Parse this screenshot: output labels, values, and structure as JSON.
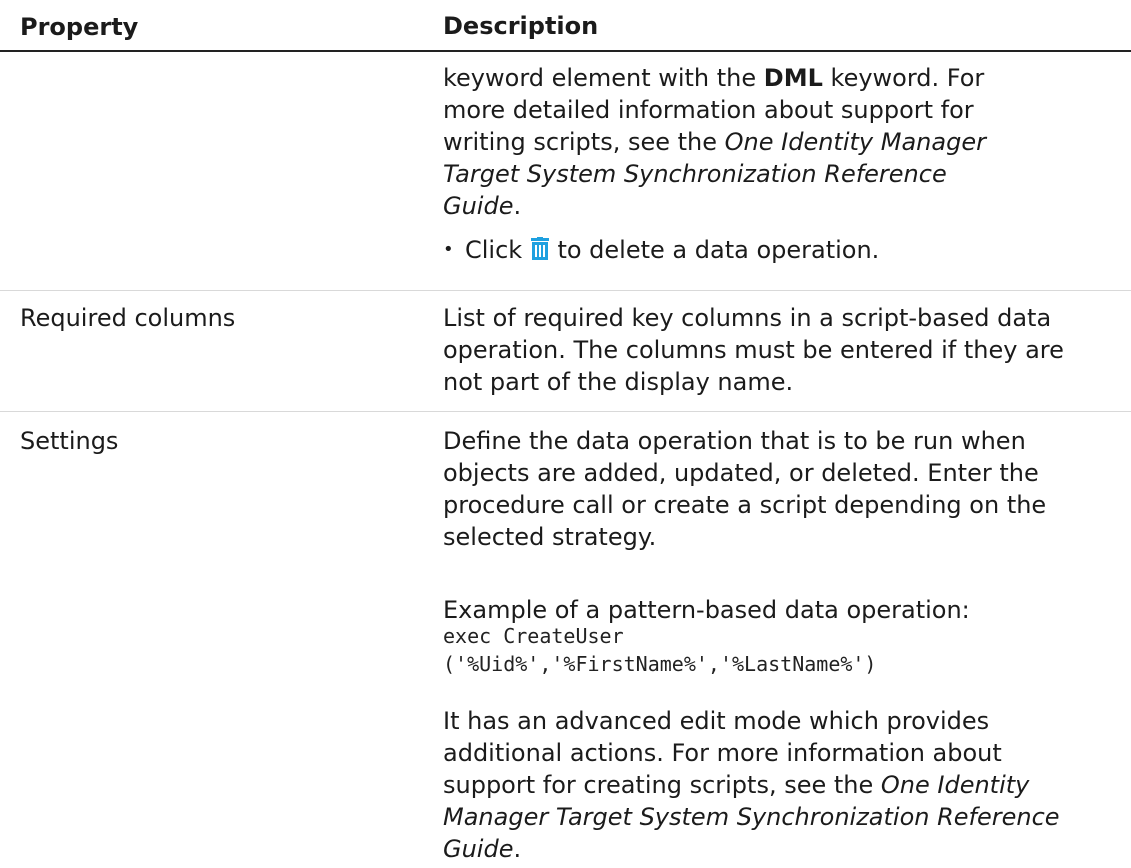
{
  "header": {
    "property": "Property",
    "description": "Description"
  },
  "row0": {
    "line1_pre": "keyword element with the ",
    "line1_bold": "DML",
    "line1_post": " keyword. For",
    "line2": "more detailed information about support for",
    "line3_pre": "writing scripts, see the ",
    "line3_italic": "One Identity Manager",
    "line4_italic": "Target System Synchronization Reference",
    "line5_italic": "Guide",
    "line5_post": ".",
    "bullet": "•",
    "bullet_pre": "Click ",
    "bullet_post": " to delete a data operation.",
    "icon_color": "#1ea0e0"
  },
  "row1": {
    "property": "Required columns",
    "line1": "List of required key columns in a script-based data",
    "line2": "operation. The columns must be entered if they are",
    "line3": "not part of the display name."
  },
  "row2": {
    "property": "Settings",
    "p1_line1": "Define the data operation that is to be run when",
    "p1_line2": "objects are added, updated, or deleted. Enter the",
    "p1_line3": "procedure call or create a script depending on the",
    "p1_line4": "selected strategy.",
    "p2": "Example of a pattern-based data operation:",
    "code1": "exec CreateUser",
    "code2": "('%Uid%','%FirstName%','%LastName%')",
    "p3_line1": "It has an advanced edit mode which provides",
    "p3_line2": "additional actions. For more information about",
    "p3_line3_pre": "support for creating scripts, see the ",
    "p3_line3_italic": "One Identity",
    "p3_line4_italic": "Manager Target System Synchronization Reference",
    "p3_line5_italic": "Guide",
    "p3_line5_post": "."
  }
}
